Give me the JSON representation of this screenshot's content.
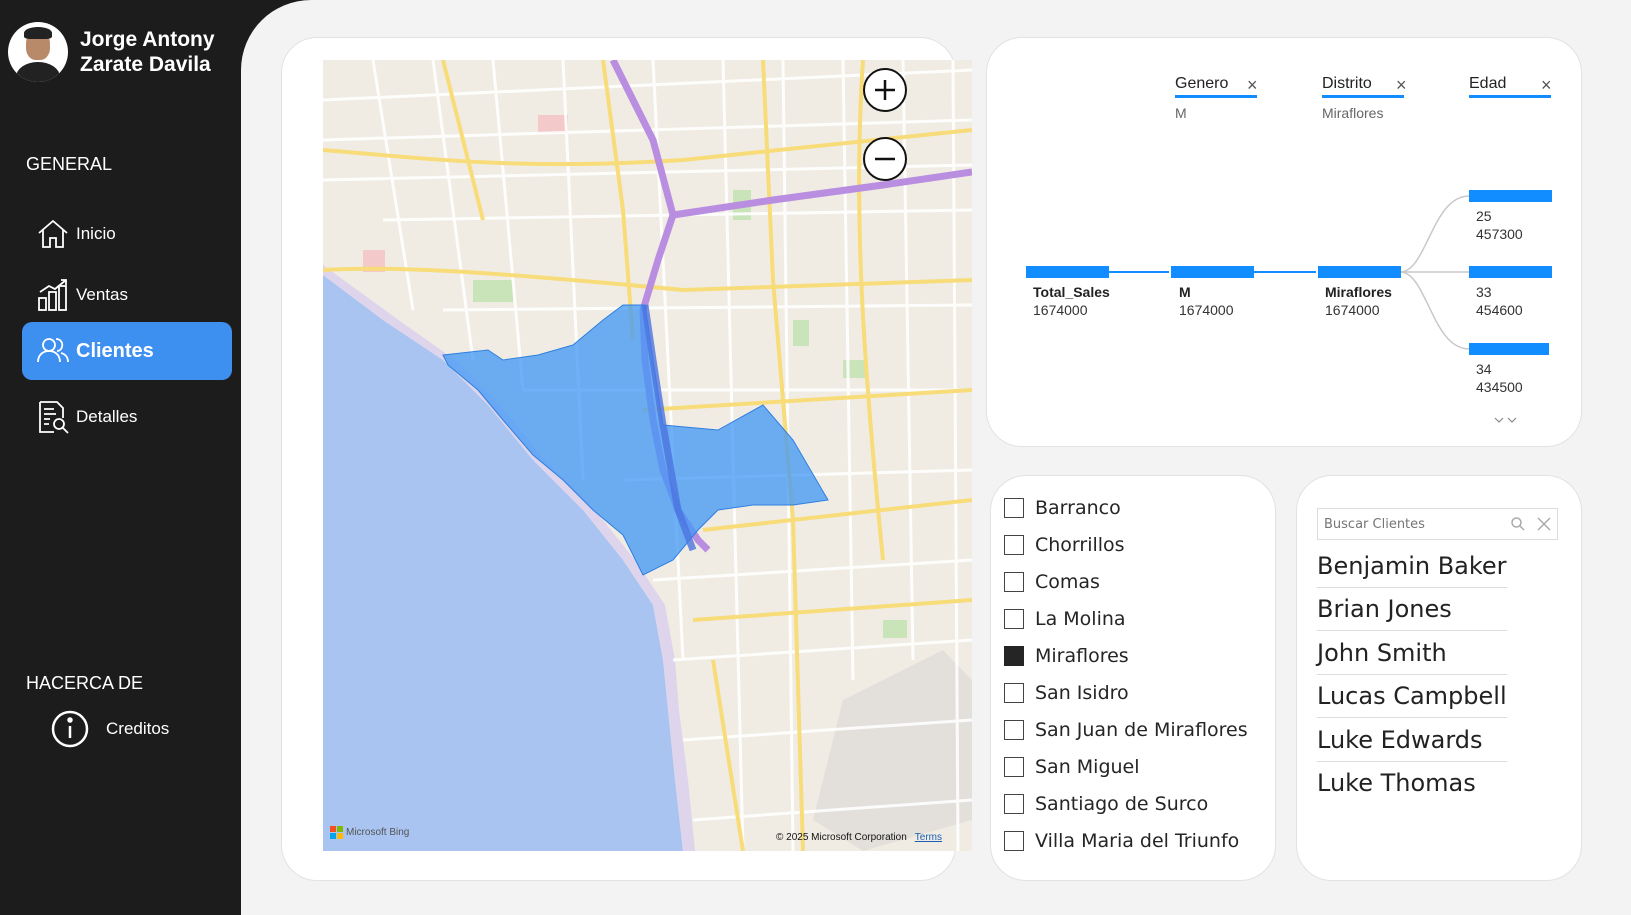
{
  "profile": {
    "name_line1": "Jorge Antony",
    "name_line2": "Zarate Davila"
  },
  "sidebar": {
    "general_title": "GENERAL",
    "items": [
      {
        "label": "Inicio",
        "icon": "home-icon"
      },
      {
        "label": "Ventas",
        "icon": "bar-chart-icon"
      },
      {
        "label": "Clientes",
        "icon": "users-icon",
        "active": true
      },
      {
        "label": "Detalles",
        "icon": "document-search-icon"
      }
    ],
    "about_title": "HACERCA DE",
    "credits_label": "Creditos"
  },
  "map": {
    "attribution": "© 2025 Microsoft Corporation",
    "terms": "Terms",
    "bing": "Microsoft Bing",
    "highlight_color": "#3f97f5"
  },
  "tree": {
    "levels": [
      {
        "label": "Genero",
        "selected": "M"
      },
      {
        "label": "Distrito",
        "selected": "Miraflores"
      },
      {
        "label": "Edad",
        "selected": ""
      }
    ],
    "nodes": [
      {
        "name": "Total_Sales",
        "value": "1674000"
      },
      {
        "name": "M",
        "value": "1674000"
      },
      {
        "name": "Miraflores",
        "value": "1674000"
      }
    ],
    "children": [
      {
        "name": "25",
        "value": "457300"
      },
      {
        "name": "33",
        "value": "454600"
      },
      {
        "name": "34",
        "value": "434500"
      }
    ],
    "bar_color": "#118dff"
  },
  "districts": [
    {
      "label": "Barranco",
      "checked": false
    },
    {
      "label": "Chorrillos",
      "checked": false
    },
    {
      "label": "Comas",
      "checked": false
    },
    {
      "label": "La Molina",
      "checked": false
    },
    {
      "label": "Miraflores",
      "checked": true
    },
    {
      "label": "San Isidro",
      "checked": false
    },
    {
      "label": "San Juan de Miraflores",
      "checked": false
    },
    {
      "label": "San Miguel",
      "checked": false
    },
    {
      "label": "Santiago de Surco",
      "checked": false
    },
    {
      "label": "Villa Maria del Triunfo",
      "checked": false
    }
  ],
  "clients": {
    "search_placeholder": "Buscar Clientes",
    "list": [
      "Benjamin Baker",
      "Brian Jones",
      "John Smith",
      "Lucas Campbell",
      "Luke Edwards",
      "Luke Thomas"
    ]
  }
}
